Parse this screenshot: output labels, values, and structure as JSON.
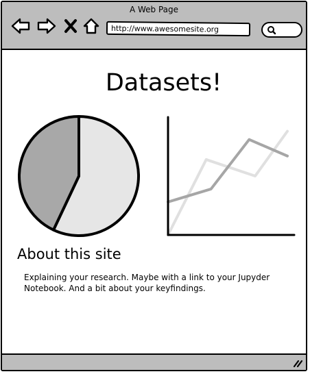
{
  "window": {
    "title": "A Web Page"
  },
  "toolbar": {
    "back_icon": "back-arrow-icon",
    "forward_icon": "forward-arrow-icon",
    "stop_icon": "close-x-icon",
    "home_icon": "home-icon",
    "url": "http://www.awesomesite.org",
    "search_icon": "search-icon"
  },
  "main": {
    "title": "Datasets!",
    "about_heading": "About this site",
    "about_text": "Explaining your research. Maybe with a link to your Jupyder Notebook. And a bit about your keyfindings."
  },
  "chart_data": [
    {
      "type": "pie",
      "values": [
        57,
        43
      ],
      "colors": [
        "#e6e6e6",
        "#a8a8a8"
      ]
    },
    {
      "type": "line",
      "x": [
        0,
        1,
        2,
        3,
        4
      ],
      "series": [
        {
          "values": [
            0,
            64,
            50,
            88,
            null
          ],
          "color": "#e0e0e0"
        },
        {
          "values": [
            28,
            39,
            81,
            67,
            null
          ],
          "color": "#a6a6a6"
        }
      ],
      "x_points": [
        [
          0,
          0.32,
          0.73,
          1.0
        ],
        [
          0,
          0.36,
          0.68,
          1.0
        ]
      ],
      "ylim": [
        0,
        100
      ],
      "grid": false
    }
  ],
  "statusbar": {
    "resize_icon": "resize-grip-icon"
  }
}
